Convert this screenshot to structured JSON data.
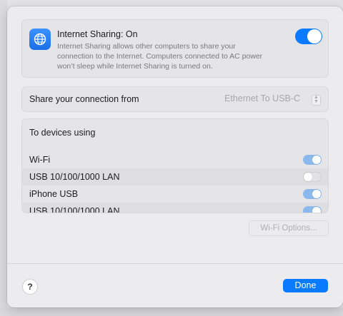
{
  "sharing": {
    "title": "Internet Sharing: On",
    "description": "Internet Sharing allows other computers to share your connection to the Internet. Computers connected to AC power won’t sleep while Internet Sharing is turned on.",
    "enabled": true,
    "icon": "globe-icon"
  },
  "share_from": {
    "label": "Share your connection from",
    "selected": "Ethernet To USB-C"
  },
  "devices": {
    "header": "To devices using",
    "items": [
      {
        "label": "Wi-Fi",
        "enabled": true
      },
      {
        "label": "USB 10/100/1000 LAN",
        "enabled": false
      },
      {
        "label": "iPhone USB",
        "enabled": true
      },
      {
        "label": "USB 10/100/1000 LAN",
        "enabled": true
      }
    ]
  },
  "buttons": {
    "wifi_options": "Wi-Fi Options...",
    "help": "?",
    "done": "Done"
  },
  "colors": {
    "accent": "#0a7bff",
    "toggle_on_dimmed": "#8cb9ec"
  }
}
